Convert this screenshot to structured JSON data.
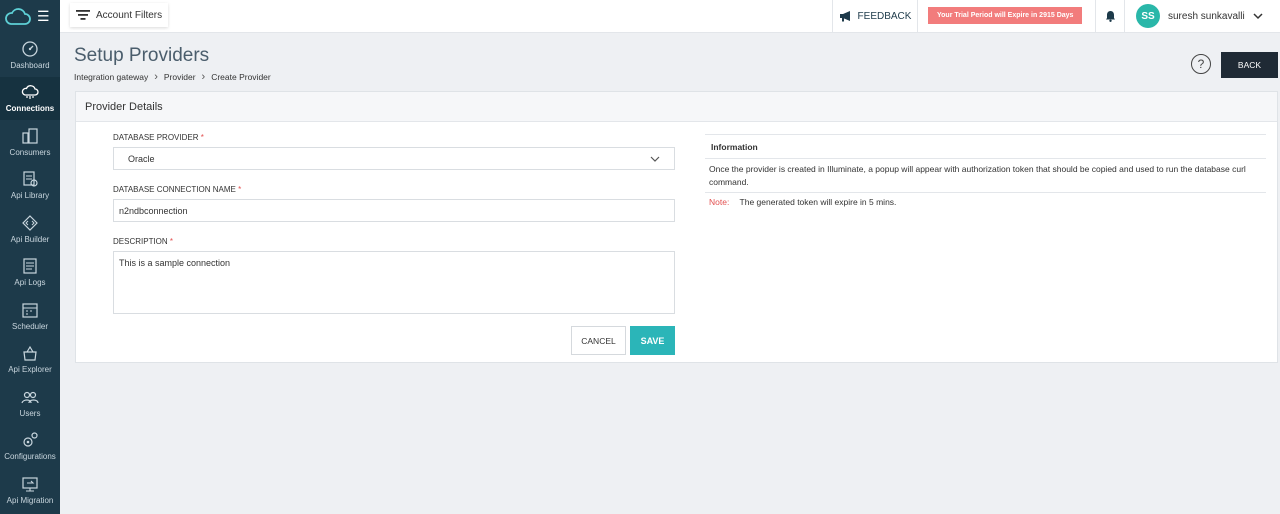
{
  "topbar": {
    "account_filters": "Account Filters",
    "feedback": "FEEDBACK",
    "trial_notice": "Your Trial Period will Expire in 2915 Days",
    "user_initials": "SS",
    "user_name": "suresh sunkavalli"
  },
  "sidebar": {
    "items": [
      {
        "label": "Dashboard",
        "icon": "dashboard-icon"
      },
      {
        "label": "Connections",
        "icon": "connections-icon"
      },
      {
        "label": "Consumers",
        "icon": "consumers-icon"
      },
      {
        "label": "Api Library",
        "icon": "api-library-icon"
      },
      {
        "label": "Api Builder",
        "icon": "api-builder-icon"
      },
      {
        "label": "Api Logs",
        "icon": "api-logs-icon"
      },
      {
        "label": "Scheduler",
        "icon": "scheduler-icon"
      },
      {
        "label": "Api Explorer",
        "icon": "api-explorer-icon"
      },
      {
        "label": "Users",
        "icon": "users-icon"
      },
      {
        "label": "Configurations",
        "icon": "configurations-icon"
      },
      {
        "label": "Api Migration",
        "icon": "api-migration-icon"
      }
    ],
    "active": "Connections"
  },
  "page": {
    "title": "Setup Providers",
    "breadcrumb": [
      "Integration gateway",
      "Provider",
      "Create Provider"
    ],
    "back_label": "BACK"
  },
  "card": {
    "title": "Provider Details",
    "form": {
      "provider_label": "DATABASE PROVIDER",
      "provider_value": "Oracle",
      "name_label": "DATABASE CONNECTION NAME",
      "name_value": "n2ndbconnection",
      "description_label": "DESCRIPTION",
      "description_value": "This is a sample connection",
      "required_mark": "*",
      "cancel_label": "CANCEL",
      "save_label": "SAVE"
    },
    "info": {
      "title": "Information",
      "text": "Once the provider is created in Illuminate, a popup will appear with authorization token that should be copied and used to run the database curl command.",
      "note_label": "Note:",
      "note_text": "The generated token will expire in 5 mins."
    }
  },
  "colors": {
    "sidebar_bg": "#1d3a4a",
    "accent": "#2bb5b8",
    "trial_bg": "#f27c7c",
    "back_bg": "#1f2a35"
  }
}
